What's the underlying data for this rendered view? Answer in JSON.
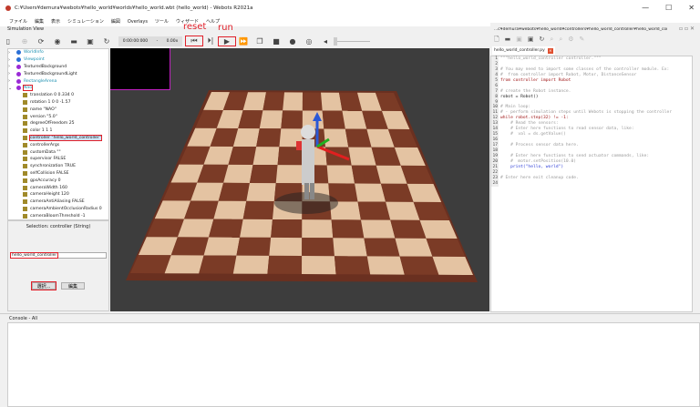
{
  "window": {
    "title": "C:¥Users¥demura¥webots¥hello_world¥worlds¥hello_world.wbt (hello_world) - Webots R2021a",
    "buttons": [
      "—",
      "☐",
      "✕"
    ]
  },
  "menu": [
    "ファイル",
    "編集",
    "表示",
    "シミュレーション",
    "編図",
    "Overlays",
    "ツール",
    "ウィザード",
    "ヘルプ"
  ],
  "sim_view_label": "Simulation View",
  "toolbar": {
    "time": "0:00:00:000",
    "speed": "0.00x",
    "annotations": {
      "reset": "reset",
      "run": "run"
    }
  },
  "scene_tree": [
    {
      "label": "WorldInfo",
      "type": "node",
      "color": "#2a6fd6",
      "link": true
    },
    {
      "label": "Viewpoint",
      "type": "node",
      "color": "#2a6fd6",
      "link": true
    },
    {
      "label": "TexturedBackground",
      "type": "node",
      "color": "#9a2ad6"
    },
    {
      "label": "TexturedBackgroundLight",
      "type": "node",
      "color": "#9a2ad6"
    },
    {
      "label": "RectangleArena",
      "type": "node",
      "color": "#9a2ad6",
      "link": true
    },
    {
      "label": "Nao",
      "type": "node",
      "color": "#9a2ad6",
      "link": true,
      "expanded": true,
      "highlight": true
    },
    {
      "label": "translation 0 0.334 0",
      "type": "field"
    },
    {
      "label": "rotation 1 0 0 -1.57",
      "type": "field"
    },
    {
      "label": "name \"NAO\"",
      "type": "field"
    },
    {
      "label": "version \"5.0\"",
      "type": "field"
    },
    {
      "label": "degreeOfFreedom 25",
      "type": "field"
    },
    {
      "label": "color 1 1 1",
      "type": "field"
    },
    {
      "label": "controller \"hello_world_controller\"",
      "type": "field",
      "selected": true,
      "highlight": true
    },
    {
      "label": "controllerArgs",
      "type": "field"
    },
    {
      "label": "customData \"\"",
      "type": "field"
    },
    {
      "label": "supervisor FALSE",
      "type": "field"
    },
    {
      "label": "synchronization TRUE",
      "type": "field"
    },
    {
      "label": "selfCollision FALSE",
      "type": "field"
    },
    {
      "label": "gpsAccuracy 0",
      "type": "field"
    },
    {
      "label": "cameraWidth 160",
      "type": "field"
    },
    {
      "label": "cameraHeight 120",
      "type": "field"
    },
    {
      "label": "cameraAntiAliasing FALSE",
      "type": "field"
    },
    {
      "label": "cameraAmbientOcclusionRadius 0",
      "type": "field"
    },
    {
      "label": "cameraBloomThreshold -1",
      "type": "field"
    }
  ],
  "field_editor": {
    "title": "Selection: controller (String)",
    "value": "hello_world_controller",
    "select_label": "選択...",
    "edit_label": "編集"
  },
  "code_editor": {
    "path": "...c¥demura¥webots¥hello_world¥controllers¥hello_world_controller¥hello_world_controller.py",
    "tab": "hello_world_controller.py",
    "lines": [
      "\"\"\"hello_world_controller controller.\"\"\"",
      "",
      "# You may need to import some classes of the controller module. Ex:",
      "#  from controller import Robot, Motor, DistanceSensor",
      "from controller import Robot",
      "",
      "# create the Robot instance.",
      "robot = Robot()",
      "",
      "# Main loop:",
      "# - perform simulation steps until Webots is stopping the controller",
      "while robot.step(32) != -1:",
      "    # Read the sensors:",
      "    # Enter here functions to read sensor data, like:",
      "    #  val = ds.getValue()",
      "",
      "    # Process sensor data here.",
      "",
      "    # Enter here functions to send actuator commands, like:",
      "    #  motor.setPosition(10.0)",
      "    print(\"hello, world\")",
      "",
      "# Enter here exit cleanup code.",
      ""
    ]
  },
  "console": {
    "title": "Console - All"
  },
  "colors": {
    "highlight": "#e0202a",
    "floor_dark": "#7b3b26",
    "floor_light": "#e4c3a2"
  }
}
